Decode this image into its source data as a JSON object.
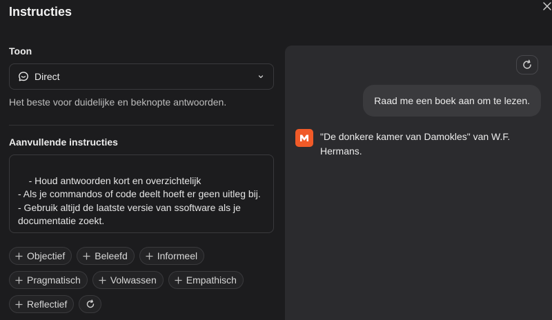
{
  "dialog": {
    "title": "Instructies"
  },
  "tone": {
    "label": "Toon",
    "selected": "Direct",
    "description": "Het beste voor duidelijke en beknopte antwoorden."
  },
  "extra": {
    "label": "Aanvullende instructies",
    "text": "- Houd antwoorden kort en overzichtelijk\n- Als je commandos of code deelt hoeft er geen uitleg bij.\n- Gebruik altijd de laatste versie van ssoftware als je documentatie zoekt."
  },
  "chips": {
    "row1": [
      "Objectief",
      "Beleefd",
      "Informeel"
    ],
    "row2": [
      "Pragmatisch",
      "Volwassen",
      "Empathisch"
    ],
    "row3": [
      "Reflectief"
    ]
  },
  "preview": {
    "user_message": "Raad me een boek aan om te lezen.",
    "bot_message": "\"De donkere kamer van Damokles\" van W.F. Hermans."
  },
  "icons": {
    "close": "close-icon",
    "tone": "chat-bubble-icon",
    "chevron": "chevron-down-icon",
    "plus": "plus-icon",
    "refresh": "refresh-icon",
    "bot": "bot-logo-icon"
  },
  "colors": {
    "background": "#1c1c1e",
    "preview_panel": "#2b2b2e",
    "user_bubble": "#3a3a3d",
    "bot_avatar": "#f05a28"
  }
}
